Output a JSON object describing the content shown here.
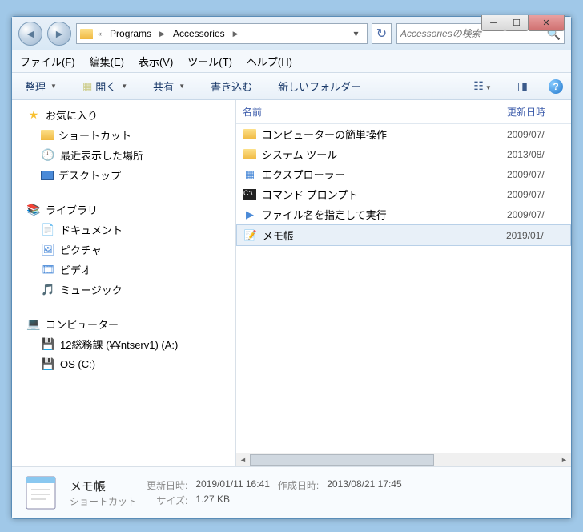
{
  "breadcrumb": {
    "sep": "«",
    "p1": "Programs",
    "p2": "Accessories"
  },
  "search": {
    "placeholder": "Accessoriesの検索"
  },
  "menu": {
    "file": "ファイル(F)",
    "edit": "編集(E)",
    "view": "表示(V)",
    "tools": "ツール(T)",
    "help": "ヘルプ(H)"
  },
  "toolbar": {
    "organize": "整理",
    "open": "開く",
    "share": "共有",
    "burn": "書き込む",
    "newfolder": "新しいフォルダー"
  },
  "nav": {
    "favorites": {
      "label": "お気に入り",
      "items": [
        "ショートカット",
        "最近表示した場所",
        "デスクトップ"
      ]
    },
    "libraries": {
      "label": "ライブラリ",
      "items": [
        "ドキュメント",
        "ピクチャ",
        "ビデオ",
        "ミュージック"
      ]
    },
    "computer": {
      "label": "コンピューター",
      "items": [
        "12総務課 (¥¥ntserv1) (A:)",
        "OS (C:)"
      ]
    }
  },
  "columns": {
    "name": "名前",
    "date": "更新日時"
  },
  "files": [
    {
      "name": "コンピューターの簡単操作",
      "date": "2009/07/",
      "icon": "folder"
    },
    {
      "name": "システム ツール",
      "date": "2013/08/",
      "icon": "folder"
    },
    {
      "name": "エクスプローラー",
      "date": "2009/07/",
      "icon": "app"
    },
    {
      "name": "コマンド プロンプト",
      "date": "2009/07/",
      "icon": "cmd"
    },
    {
      "name": "ファイル名を指定して実行",
      "date": "2009/07/",
      "icon": "run"
    },
    {
      "name": "メモ帳",
      "date": "2019/01/",
      "icon": "note",
      "selected": true
    }
  ],
  "details": {
    "name": "メモ帳",
    "type": "ショートカット",
    "labels": {
      "modified": "更新日時:",
      "created": "作成日時:",
      "size": "サイズ:"
    },
    "modified": "2019/01/11 16:41",
    "created": "2013/08/21 17:45",
    "size": "1.27 KB"
  }
}
